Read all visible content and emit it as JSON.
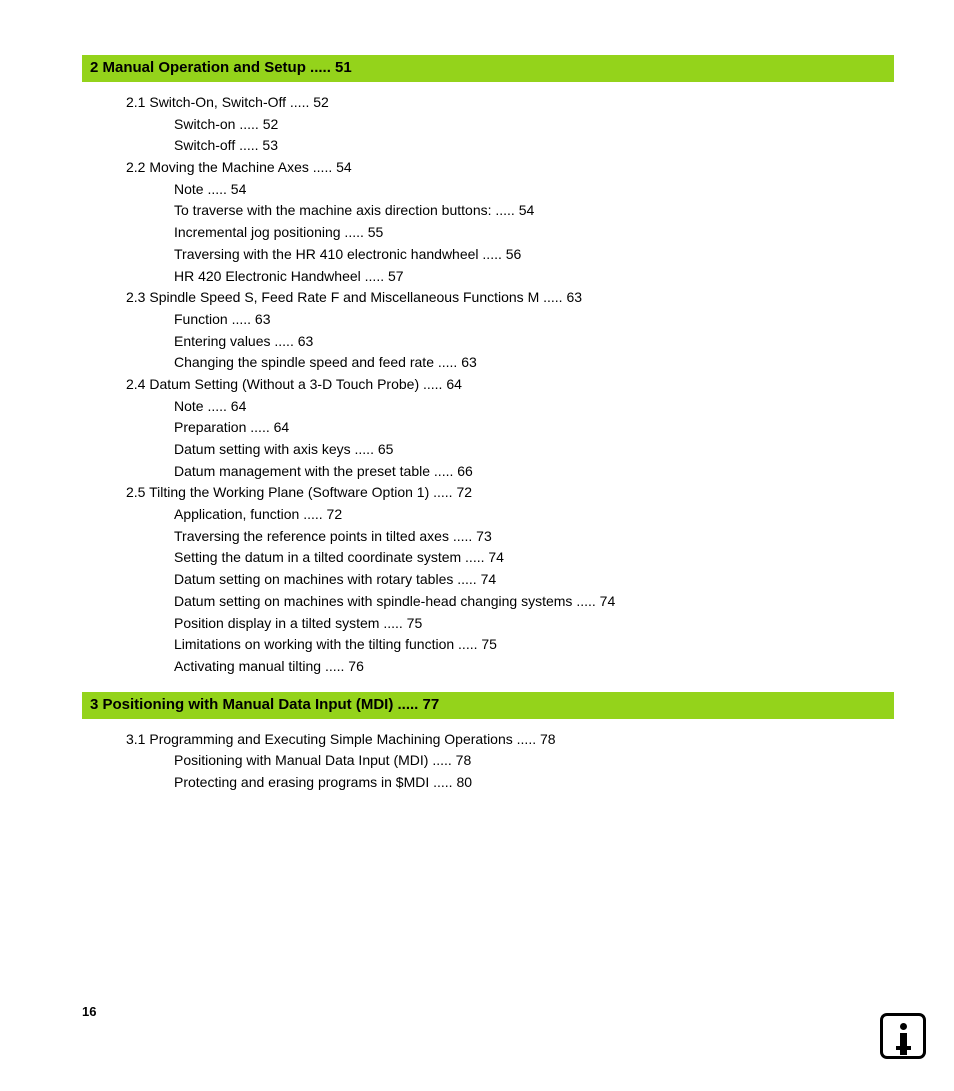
{
  "page_number": "16",
  "chapters": [
    {
      "heading": "2 Manual Operation and Setup ..... 51",
      "sections": [
        {
          "line": "2.1  Switch-On, Switch-Off ..... 52",
          "subs": [
            "Switch-on ..... 52",
            "Switch-off ..... 53"
          ]
        },
        {
          "line": "2.2  Moving the Machine Axes ..... 54",
          "subs": [
            "Note ..... 54",
            "To traverse with the machine axis direction buttons: ..... 54",
            "Incremental jog positioning ..... 55",
            "Traversing with the HR 410 electronic handwheel ..... 56",
            "HR 420 Electronic Handwheel ..... 57"
          ]
        },
        {
          "line": "2.3 Spindle Speed S, Feed Rate F and Miscellaneous Functions M ..... 63",
          "subs": [
            "Function ..... 63",
            "Entering values ..... 63",
            "Changing the spindle speed and feed rate ..... 63"
          ]
        },
        {
          "line": "2.4 Datum Setting (Without a 3-D Touch Probe) ..... 64",
          "subs": [
            "Note ..... 64",
            "Preparation ..... 64",
            "Datum setting with axis keys ..... 65",
            "Datum management with the preset table ..... 66"
          ]
        },
        {
          "line": "2.5 Tilting the Working Plane (Software Option 1) ..... 72",
          "subs": [
            "Application, function ..... 72",
            "Traversing the reference points in tilted axes ..... 73",
            "Setting the datum in a tilted coordinate system ..... 74",
            "Datum setting on machines with rotary tables ..... 74",
            "Datum setting on machines with spindle-head changing systems ..... 74",
            "Position display in a tilted system ..... 75",
            "Limitations on working with the tilting function ..... 75",
            "Activating manual tilting ..... 76"
          ]
        }
      ]
    },
    {
      "heading": "3 Positioning with Manual Data Input (MDI) ..... 77",
      "sections": [
        {
          "line": "3.1 Programming and Executing Simple Machining Operations ..... 78",
          "subs": [
            "Positioning with Manual Data Input (MDI) ..... 78",
            "Protecting and erasing programs in $MDI ..... 80"
          ]
        }
      ]
    }
  ]
}
